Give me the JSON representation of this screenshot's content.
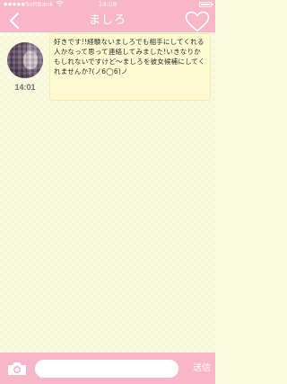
{
  "status_bar": {
    "signal": "●●●●●",
    "carrier": "SoftBank",
    "time": "14:09"
  },
  "header": {
    "title": "ましろ",
    "back_icon": "chevron-left-icon",
    "favorite_icon": "heart-outline-icon"
  },
  "conversation": {
    "messages": [
      {
        "sender_avatar": "avatar",
        "time": "14:01",
        "text": "好きです!!経験ないましろでも相手にしてくれる人かなって思って連絡してみました!いきなりかもしれないですけど〜ましろを彼女候補にしてくれませんか?(ノ6◯6)ノ"
      }
    ]
  },
  "composer": {
    "camera_icon": "camera-icon",
    "input_value": "",
    "input_placeholder": "",
    "send_label": "送信"
  },
  "colors": {
    "header_pink": "#f7b6c9",
    "chat_background": "#fbfbdf",
    "bubble": "#fffad2"
  }
}
